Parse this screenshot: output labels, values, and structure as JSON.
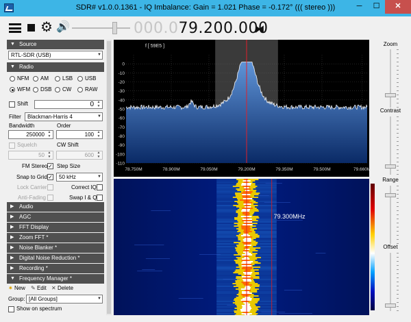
{
  "window": {
    "title": "SDR# v1.0.0.1361 - IQ Imbalance: Gain = 1.021 Phase = -0.172° ((( stereo )))",
    "min_glyph": "─",
    "max_glyph": "☐",
    "close_glyph": "✕"
  },
  "toolbar": {
    "freq_dim": "000.0",
    "freq_main": "79.200.000",
    "gear_glyph": "⚙",
    "speaker_glyph": "🔊",
    "swap_glyph": "⧓",
    "volume_level": 0.75
  },
  "sections": {
    "source": "Source",
    "radio": "Radio",
    "audio": "Audio",
    "agc": "AGC",
    "fft_display": "FFT Display",
    "zoom_fft": "Zoom FFT *",
    "noise_blanker": "Noise Blanker *",
    "digital_noise_reduction": "Digital Noise Reduction *",
    "recording": "Recording *",
    "frequency_manager": "Frequency Manager *"
  },
  "source": {
    "device": "RTL-SDR (USB)"
  },
  "radio": {
    "modes": [
      "NFM",
      "AM",
      "LSB",
      "USB",
      "WFM",
      "DSB",
      "CW",
      "RAW"
    ],
    "selected_mode": "WFM",
    "shift_label": "Shift",
    "shift_value": "0",
    "filter_label": "Filter",
    "filter_value": "Blackman-Harris 4",
    "bandwidth_label": "Bandwidth",
    "bandwidth_value": "250000",
    "order_label": "Order",
    "order_value": "100",
    "squelch_label": "Squelch",
    "squelch_value": "50",
    "cw_shift_label": "CW Shift",
    "cw_shift_value": "600",
    "fm_stereo_label": "FM Stereo",
    "step_size_label": "Step Size",
    "snap_to_grid_label": "Snap to Grid",
    "step_value": "50 kHz",
    "lock_carrier_label": "Lock Carrier",
    "correct_iq_label": "Correct IQ",
    "anti_fading_label": "Anti-Fading",
    "swap_iq_label": "Swap I & Q"
  },
  "freq_manager": {
    "new_label": "New",
    "edit_label": "Edit",
    "delete_label": "Delete",
    "group_label": "Group:",
    "group_value": "[All Groups]",
    "show_on_spectrum_label": "Show on spectrum"
  },
  "spectrum": {
    "rds_label": "f [ 59E5 ]",
    "y_ticks": [
      "0",
      "-10",
      "-20",
      "-30",
      "-40",
      "-50",
      "-60",
      "-70",
      "-80",
      "-90",
      "-100",
      "-110"
    ],
    "x_ticks": [
      "78.750M",
      "78.900M",
      "79.050M",
      "79.200M",
      "79.350M",
      "79.500M",
      "79.660M"
    ],
    "center_mhz": 79.2,
    "span_mhz": [
      78.72,
      79.68
    ],
    "filter_band_mhz": [
      79.075,
      79.325
    ],
    "peak_db": 2,
    "floor_db": -48
  },
  "waterfall": {
    "hover_label": "79.300MHz",
    "hover_mhz": 79.3
  },
  "right_panel": {
    "zoom_label": "Zoom",
    "contrast_label": "Contrast",
    "range_label": "Range",
    "offset_label": "Offset"
  }
}
